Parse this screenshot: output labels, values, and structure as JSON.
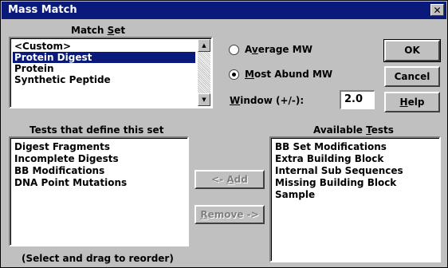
{
  "window": {
    "title": "Mass Match",
    "close_glyph": "✕"
  },
  "match_set": {
    "label": "Match Set",
    "items": [
      {
        "label": "<Custom>",
        "selected": false
      },
      {
        "label": "Protein Digest",
        "selected": true
      },
      {
        "label": "Protein",
        "selected": false
      },
      {
        "label": "Synthetic Peptide",
        "selected": false
      }
    ]
  },
  "mw_options": [
    {
      "label": "Average MW",
      "checked": false
    },
    {
      "label": "Most Abund MW",
      "checked": true
    }
  ],
  "window_field": {
    "label": "Window (+/-):",
    "value": "2.0"
  },
  "buttons": {
    "ok": "OK",
    "cancel": "Cancel",
    "help": "Help",
    "add": "<- Add",
    "remove": "Remove ->"
  },
  "tests_in_set": {
    "label": "Tests that define this set",
    "items": [
      "Digest Fragments",
      "Incomplete Digests",
      "BB Modifications",
      "DNA Point Mutations"
    ],
    "hint": "(Select and drag to reorder)"
  },
  "available_tests": {
    "label": "Available Tests",
    "items": [
      "BB Set Modifications",
      "Extra Building Block",
      "Internal Sub Sequences",
      "Missing Building Block",
      "Sample"
    ]
  },
  "colors": {
    "title_bar": "#0a1a7a",
    "selection": "#0a1a7a",
    "face": "#c0c0c0"
  }
}
